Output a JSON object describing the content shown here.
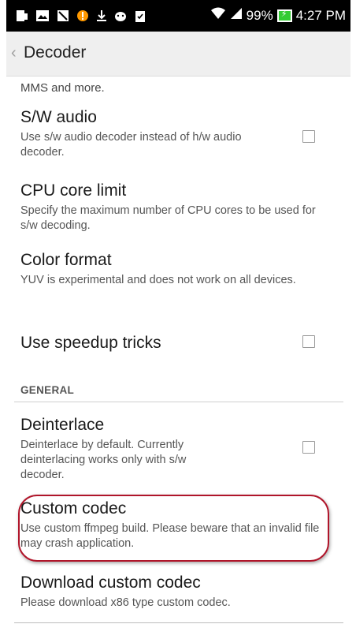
{
  "status_bar": {
    "battery": "99%",
    "time": "4:27 PM",
    "icons": [
      "notification-icon",
      "image-icon",
      "block-icon",
      "warning-icon",
      "download-icon",
      "android-icon",
      "clipboard-icon",
      "wifi-icon",
      "signal-icon",
      "battery-icon"
    ]
  },
  "action_bar": {
    "title": "Decoder"
  },
  "list": {
    "truncated_text": "MMS and more.",
    "items": [
      {
        "title": "S/W audio",
        "summary": "Use s/w audio decoder instead of h/w audio decoder."
      },
      {
        "title": "CPU core limit",
        "summary": "Specify the maximum number of CPU cores to be used for s/w decoding."
      },
      {
        "title": "Color format",
        "summary": "YUV is experimental and does not work on all devices."
      },
      {
        "title": "Use speedup tricks",
        "summary": ""
      }
    ],
    "section_general": "GENERAL",
    "general_items": [
      {
        "title": "Deinterlace",
        "summary": "Deinterlace by default. Currently deinterlacing works only with s/w decoder."
      },
      {
        "title": "Custom codec",
        "summary": "Use custom ffmpeg build. Please beware that an invalid file may crash application."
      },
      {
        "title": "Download custom codec",
        "summary": "Please download x86 type custom codec."
      }
    ]
  },
  "colors": {
    "highlight": "#b0152a",
    "battery": "#33cc33"
  }
}
